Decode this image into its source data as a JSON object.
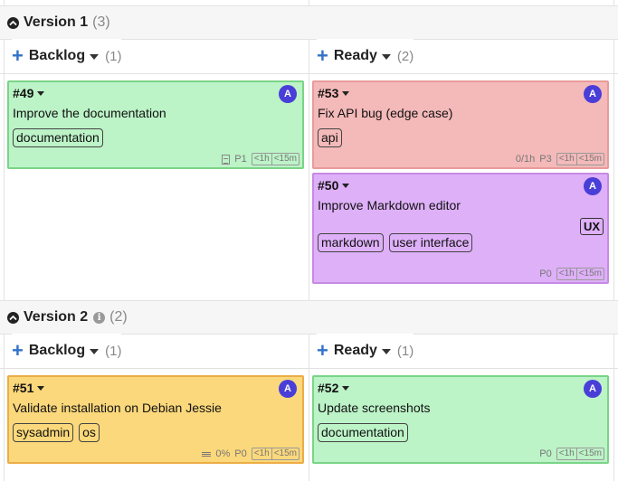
{
  "versions": [
    {
      "title": "Version 1",
      "count": "(3)",
      "columns": [
        {
          "name": "Backlog",
          "count": "(1)"
        },
        {
          "name": "Ready",
          "count": "(2)"
        }
      ]
    },
    {
      "title": "Version 2",
      "count": "(2)",
      "info_icon": "i",
      "columns": [
        {
          "name": "Backlog",
          "count": "(1)"
        },
        {
          "name": "Ready",
          "count": "(1)"
        }
      ]
    }
  ],
  "add_icon": "+",
  "cards": {
    "c49": {
      "number": "#49",
      "title": "Improve the documentation",
      "tags": [
        "documentation"
      ],
      "avatar": "A",
      "priority": "P1",
      "est1": "<1h",
      "est2": "<15m",
      "color": "#bcf3c7"
    },
    "c53": {
      "number": "#53",
      "title": "Fix API bug (edge case)",
      "tags": [
        "api"
      ],
      "avatar": "A",
      "time": "0/1h",
      "priority": "P3",
      "est1": "<1h",
      "est2": "<15m",
      "color": "#f4b9b9"
    },
    "c50": {
      "number": "#50",
      "title": "Improve Markdown editor",
      "tags": [
        "markdown",
        "user interface"
      ],
      "badge": "UX",
      "avatar": "A",
      "priority": "P0",
      "est1": "<1h",
      "est2": "<15m",
      "color": "#deb0f8"
    },
    "c51": {
      "number": "#51",
      "title": "Validate installation on Debian Jessie",
      "tags": [
        "sysadmin",
        "os"
      ],
      "avatar": "A",
      "progress": "0%",
      "priority": "P0",
      "est1": "<1h",
      "est2": "<15m",
      "color": "#fbd87b"
    },
    "c52": {
      "number": "#52",
      "title": "Update screenshots",
      "tags": [
        "documentation"
      ],
      "avatar": "A",
      "priority": "P0",
      "est1": "<1h",
      "est2": "<15m",
      "color": "#bcf3c7"
    }
  },
  "colors": {
    "accent": "#3372c9",
    "avatar": "#4a3ed8"
  }
}
